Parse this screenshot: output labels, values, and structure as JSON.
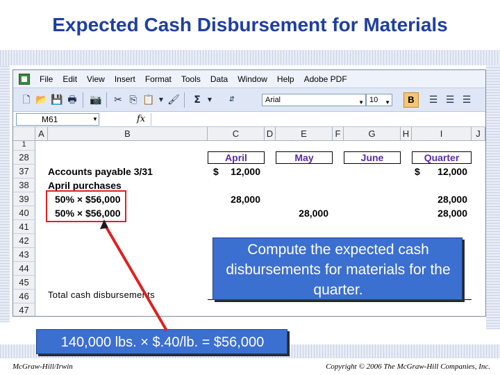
{
  "slide": {
    "title": "Expected Cash Disbursement for Materials",
    "footer_left": "McGraw-Hill/Irwin",
    "footer_right": "Copyright © 2006 The McGraw-Hill Companies, Inc."
  },
  "excel": {
    "menu": [
      "File",
      "Edit",
      "View",
      "Insert",
      "Format",
      "Tools",
      "Data",
      "Window",
      "Help",
      "Adobe PDF"
    ],
    "font_name": "Arial",
    "font_size": "10",
    "bold_label": "B",
    "sigma": "Σ",
    "name_box": "M61",
    "fx": "fx",
    "columns": [
      "A",
      "B",
      "C",
      "D",
      "E",
      "F",
      "G",
      "H",
      "I",
      "J"
    ],
    "top_row": "1",
    "rows": [
      "28",
      "37",
      "38",
      "39",
      "40",
      "41",
      "42",
      "43",
      "44",
      "45",
      "46",
      "47"
    ],
    "month_headers": {
      "april": "April",
      "may": "May",
      "june": "June",
      "quarter": "Quarter"
    },
    "cells": {
      "r37_label": "Accounts payable 3/31",
      "r37_april_dollar": "$",
      "r37_april": "12,000",
      "r37_quarter_dollar": "$",
      "r37_quarter": "12,000",
      "r38_label": "April purchases",
      "r39_label": "50% × $56,000",
      "r39_april": "28,000",
      "r39_quarter": "28,000",
      "r40_label": "50% × $56,000",
      "r40_may": "28,000",
      "r40_quarter": "28,000",
      "r46_label": "Total cash disbursements"
    }
  },
  "callouts": {
    "compute": "Compute the expected cash disbursements for materials for the quarter.",
    "calc": "140,000 lbs. × $.40/lb. = $56,000"
  },
  "colors": {
    "title": "#1f3f9f",
    "callout_bg": "#3b6fd0",
    "highlight_box": "#e02020",
    "header_text": "#5a2aa8"
  }
}
